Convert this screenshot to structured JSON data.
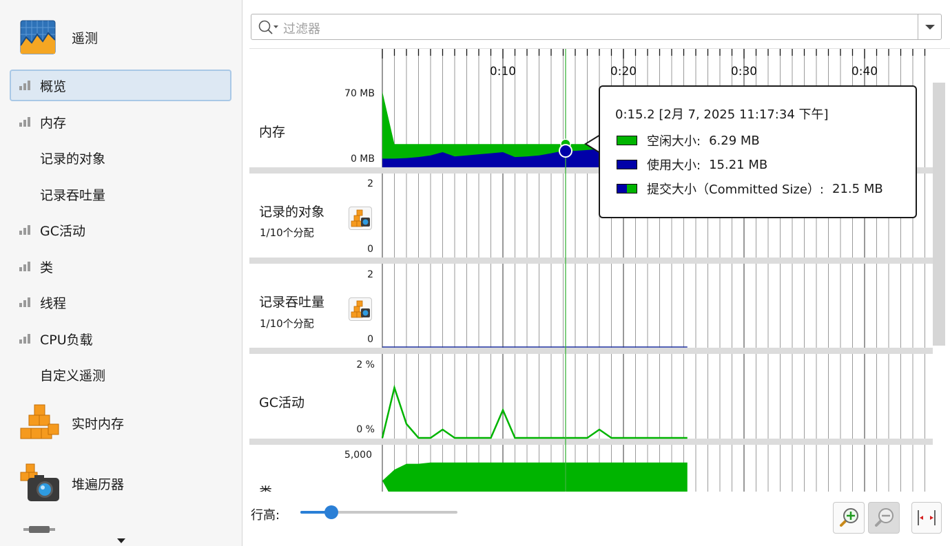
{
  "sidebar": {
    "header": {
      "label": "遥测",
      "icon": "telemetry-icon"
    },
    "items": [
      {
        "label": "概览",
        "selected": true,
        "has_icon": true
      },
      {
        "label": "内存",
        "selected": false,
        "has_icon": true
      },
      {
        "label": "记录的对象",
        "selected": false,
        "has_icon": false
      },
      {
        "label": "记录吞吐量",
        "selected": false,
        "has_icon": false
      },
      {
        "label": "GC活动",
        "selected": false,
        "has_icon": true
      },
      {
        "label": "类",
        "selected": false,
        "has_icon": true
      },
      {
        "label": "线程",
        "selected": false,
        "has_icon": true
      },
      {
        "label": "CPU负载",
        "selected": false,
        "has_icon": true
      },
      {
        "label": "自定义遥测",
        "selected": false,
        "has_icon": false
      }
    ],
    "sections": [
      {
        "label": "实时内存",
        "icon": "live-memory-icon"
      },
      {
        "label": "堆遍历器",
        "icon": "heap-walker-icon"
      }
    ]
  },
  "filter": {
    "placeholder": "过滤器"
  },
  "timeline": {
    "ticks": [
      "0:10",
      "0:20",
      "0:30",
      "0:40"
    ]
  },
  "rows": {
    "memory": {
      "label": "内存",
      "ymax": "70 MB",
      "ymin": "0 MB"
    },
    "recorded_objects": {
      "label": "记录的对象",
      "sub": "1/10个分配",
      "ymax": "2",
      "ymin": "0"
    },
    "recorded_throughput": {
      "label": "记录吞吐量",
      "sub": "1/10个分配",
      "ymax": "2",
      "ymin": "0"
    },
    "gc_activity": {
      "label": "GC活动",
      "ymax": "2 %",
      "ymin": "0 %"
    },
    "classes": {
      "label": "类",
      "ymax": "5,000"
    }
  },
  "colors": {
    "free": "#00b400",
    "used": "#0000a8",
    "gc_line": "#00b400",
    "cursor": "#3cb43c"
  },
  "chart_data": {
    "type": "area",
    "x_unit": "seconds",
    "xlim": [
      0,
      45
    ],
    "cursor_time": 15.2,
    "memory": {
      "ylim": [
        0,
        70
      ],
      "x": [
        0,
        1,
        2,
        3,
        4,
        5,
        6,
        7,
        8,
        9,
        10,
        11,
        12,
        13,
        14,
        15,
        16,
        17,
        18,
        19,
        20,
        21,
        22,
        23,
        24,
        25
      ],
      "used": [
        8,
        8,
        8.5,
        9.5,
        11,
        14,
        10,
        11,
        12,
        13,
        14,
        9.5,
        10,
        11,
        13,
        15.2,
        15.2,
        16,
        17,
        17.5,
        18,
        18.5,
        19,
        19.5,
        20,
        20
      ],
      "committed": [
        70,
        21.5,
        21.5,
        21.5,
        21.5,
        21.5,
        21.5,
        21.5,
        21.5,
        21.5,
        21.5,
        21.5,
        21.5,
        21.5,
        21.5,
        21.5,
        21.5,
        21.5,
        21.5,
        21.5,
        21.5,
        21.5,
        21.5,
        21.5,
        21.5,
        21.5
      ]
    },
    "recorded_throughput": {
      "ylim": [
        0,
        2
      ],
      "x": [
        0,
        25.3
      ],
      "values": [
        0,
        0
      ]
    },
    "gc_activity": {
      "ylim": [
        0,
        2
      ],
      "x": [
        0,
        1,
        2,
        3,
        4,
        5,
        6,
        7,
        8,
        9,
        10,
        11,
        12,
        13,
        14,
        15,
        16,
        17,
        18,
        19,
        20,
        21,
        22,
        23,
        24,
        25.3
      ],
      "values": [
        0,
        1.8,
        0.5,
        0,
        0,
        0.3,
        0,
        0,
        0,
        0,
        1.0,
        0,
        0,
        0,
        0,
        0,
        0,
        0,
        0.3,
        0,
        0,
        0,
        0,
        0,
        0,
        0
      ]
    },
    "classes": {
      "ylim": [
        0,
        5000
      ],
      "x": [
        0,
        1,
        2,
        3,
        4,
        25.3
      ],
      "values": [
        3300,
        4150,
        4600,
        4600,
        4700,
        4700
      ]
    }
  },
  "tooltip": {
    "title": "0:15.2 [2月 7, 2025 11:17:34 下午]",
    "rows": [
      {
        "name": "空闲大小:",
        "value": "6.29 MB",
        "swatch": "free"
      },
      {
        "name": "使用大小:",
        "value": "15.21 MB",
        "swatch": "used"
      },
      {
        "name": "提交大小（Committed Size）:",
        "value": "21.5 MB",
        "swatch": "committed"
      }
    ]
  },
  "bottom": {
    "row_height_label": "行高:",
    "row_height_value": 0.17
  },
  "toolbar": {
    "zoom_in": "zoom-in",
    "zoom_out": "zoom-out",
    "fit": "fit-width"
  }
}
